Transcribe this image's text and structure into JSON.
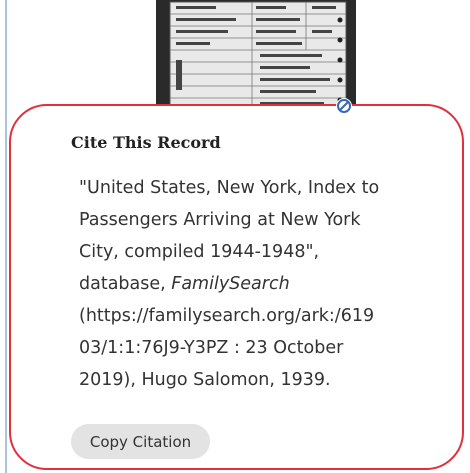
{
  "record_image": {
    "icon": "record-image-thumbnail"
  },
  "viewer_icon": "restricted-view-icon",
  "citation": {
    "title": "Cite This Record",
    "lines": [
      "\"United States, New York, Index to",
      "Passengers Arriving at New York",
      "City, compiled 1944-1948\",",
      "database, ",
      "(https://familysearch.org/ark:/619",
      "03/1:1:76J9-Y3PZ : 23 October",
      "2019), Hugo Salomon, 1939."
    ],
    "database_name": "FamilySearch",
    "copy_label": "Copy Citation"
  },
  "colors": {
    "card_border": "#e0303d",
    "button_bg": "#e3e3e3",
    "page_rule": "#a8c4e0"
  }
}
